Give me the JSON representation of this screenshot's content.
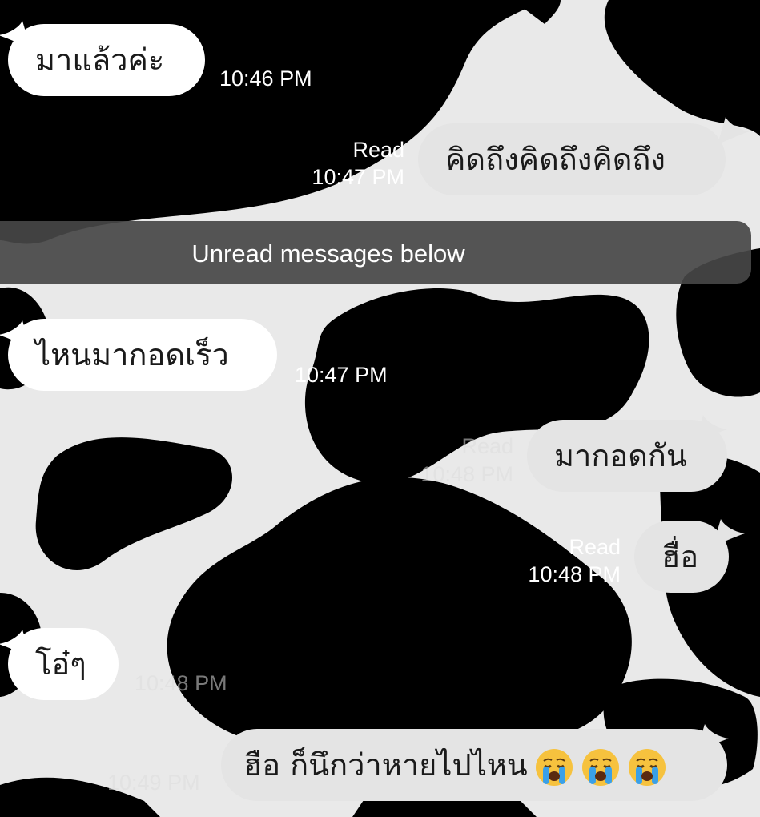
{
  "chat": {
    "unread_divider": "Unread messages below",
    "messages": [
      {
        "direction": "incoming",
        "text": "มาแล้วค่ะ",
        "time": "10:46 PM"
      },
      {
        "direction": "outgoing",
        "text": "คิดถึงคิดถึงคิดถึง",
        "status": "Read",
        "time": "10:47 PM"
      },
      {
        "direction": "incoming",
        "text": "ไหนมากอดเร็ว",
        "time": "10:47 PM"
      },
      {
        "direction": "outgoing",
        "text": "มากอดกัน",
        "status": "Read",
        "time": "10:48 PM"
      },
      {
        "direction": "outgoing",
        "text": "ฮื่อ",
        "status": "Read",
        "time": "10:48 PM"
      },
      {
        "direction": "incoming",
        "text": "โอ๋ๆ",
        "time": "10:48 PM"
      },
      {
        "direction": "outgoing",
        "text": "ฮือ ก็นึกว่าหายไปไหน",
        "emoji": [
          "crying-face",
          "crying-face",
          "crying-face"
        ],
        "time": "10:49 PM"
      }
    ]
  },
  "colors": {
    "background_light": "#e9e9e9",
    "background_spots": "#000000",
    "incoming_bubble": "#ffffff",
    "outgoing_bubble": "#e4e4e4",
    "divider": "#464646"
  }
}
